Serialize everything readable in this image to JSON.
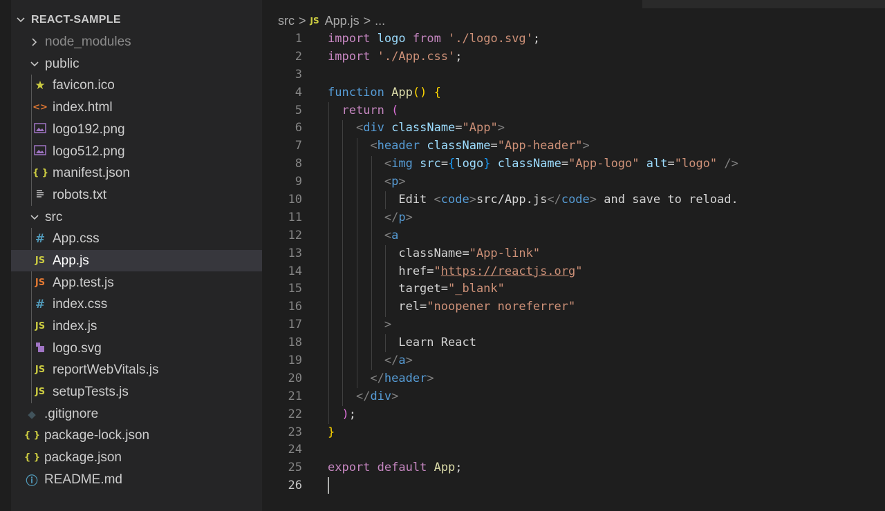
{
  "explorer": {
    "root": "REACT-SAMPLE",
    "items": [
      {
        "label": "node_modules",
        "icon": "chevron-right",
        "type": "folder-collapsed"
      },
      {
        "label": "public",
        "icon": "chevron-down",
        "type": "folder-expanded"
      },
      {
        "label": "favicon.ico",
        "icon": "star-icon",
        "type": "file"
      },
      {
        "label": "index.html",
        "icon": "html-icon",
        "type": "file"
      },
      {
        "label": "logo192.png",
        "icon": "image-icon",
        "type": "file"
      },
      {
        "label": "logo512.png",
        "icon": "image-icon",
        "type": "file"
      },
      {
        "label": "manifest.json",
        "icon": "json-icon",
        "type": "file"
      },
      {
        "label": "robots.txt",
        "icon": "text-icon",
        "type": "file"
      },
      {
        "label": "src",
        "icon": "chevron-down",
        "type": "folder-expanded"
      },
      {
        "label": "App.css",
        "icon": "css-icon",
        "type": "file"
      },
      {
        "label": "App.js",
        "icon": "js-icon",
        "type": "file",
        "selected": true
      },
      {
        "label": "App.test.js",
        "icon": "js-test-icon",
        "type": "file"
      },
      {
        "label": "index.css",
        "icon": "css-icon",
        "type": "file"
      },
      {
        "label": "index.js",
        "icon": "js-icon",
        "type": "file"
      },
      {
        "label": "logo.svg",
        "icon": "svg-icon",
        "type": "file"
      },
      {
        "label": "reportWebVitals.js",
        "icon": "js-icon",
        "type": "file"
      },
      {
        "label": "setupTests.js",
        "icon": "js-icon",
        "type": "file"
      },
      {
        "label": ".gitignore",
        "icon": "git-icon",
        "type": "file"
      },
      {
        "label": "package-lock.json",
        "icon": "json-icon",
        "type": "file"
      },
      {
        "label": "package.json",
        "icon": "json-icon",
        "type": "file"
      },
      {
        "label": "README.md",
        "icon": "info-icon",
        "type": "file"
      }
    ],
    "icon_glyphs": {
      "star": "★",
      "html": "<>",
      "json": "{ }",
      "css": "#",
      "js": "JS",
      "info": "ⓘ",
      "git": "◆"
    }
  },
  "breadcrumb": {
    "folder": "src",
    "file_badge": "JS",
    "file": "App.js",
    "more": "...",
    "separator": ">"
  },
  "editor": {
    "language": "javascript",
    "active_line": 26,
    "line_numbers": [
      "1",
      "2",
      "3",
      "4",
      "5",
      "6",
      "7",
      "8",
      "9",
      "10",
      "11",
      "12",
      "13",
      "14",
      "15",
      "16",
      "17",
      "18",
      "19",
      "20",
      "21",
      "22",
      "23",
      "24",
      "25",
      "26"
    ],
    "lines": [
      "import logo from './logo.svg';",
      "import './App.css';",
      "",
      "function App() {",
      "  return (",
      "    <div className=\"App\">",
      "      <header className=\"App-header\">",
      "        <img src={logo} className=\"App-logo\" alt=\"logo\" />",
      "        <p>",
      "          Edit <code>src/App.js</code> and save to reload.",
      "        </p>",
      "        <a",
      "          className=\"App-link\"",
      "          href=\"https://reactjs.org\"",
      "          target=\"_blank\"",
      "          rel=\"noopener noreferrer\"",
      "        >",
      "          Learn React",
      "        </a>",
      "      </header>",
      "    </div>",
      "  );",
      "}",
      "",
      "export default App;",
      ""
    ]
  },
  "colors": {
    "editor_bg": "#1e1e1e",
    "sidebar_bg": "#252526",
    "selection_bg": "#37373d",
    "keyword": "#c586c0",
    "storage": "#569cd6",
    "function": "#dcdcaa",
    "variable": "#9cdcfe",
    "string": "#ce9178",
    "js_badge": "#cbcb41"
  }
}
